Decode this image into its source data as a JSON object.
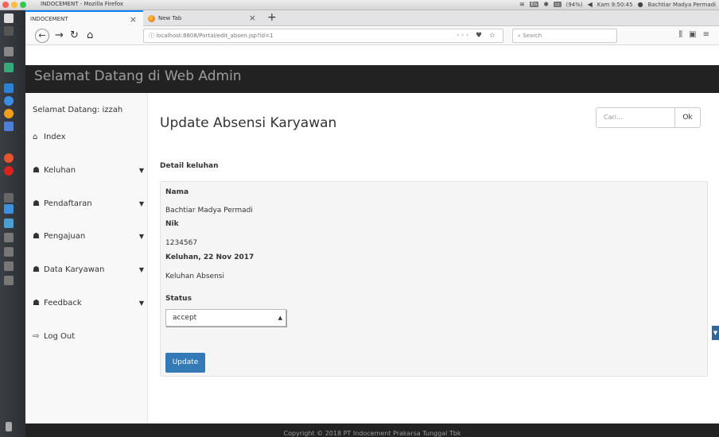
{
  "os": {
    "window_title": "INDOCEMENT - Mozilla Firefox",
    "lang": "En",
    "battery": "(94%)",
    "clock": "Kam 9:50:45",
    "user": "Bachtiar Madya Permadi"
  },
  "browser": {
    "tabs": [
      {
        "label": "INDOCEMENT"
      },
      {
        "label": "New Tab"
      }
    ],
    "url": "localhost:8808/Portal/edit_absen.jsp?id=1",
    "url_host": "localhost",
    "search_placeholder": "Search"
  },
  "header": {
    "brand": "Selamat Datang di Web Admin"
  },
  "sidebar": {
    "welcome": "Selamat Datang: izzah",
    "items": [
      {
        "label": "Index",
        "icon": "home-icon"
      },
      {
        "label": "Keluhan",
        "icon": "users-icon"
      },
      {
        "label": "Pendaftaran",
        "icon": "users-icon"
      },
      {
        "label": "Pengajuan",
        "icon": "users-icon"
      },
      {
        "label": "Data Karyawan",
        "icon": "users-icon"
      },
      {
        "label": "Feedback",
        "icon": "users-icon"
      },
      {
        "label": "Log Out",
        "icon": "logout-icon"
      }
    ]
  },
  "main": {
    "title": "Update Absensi Karyawan",
    "search_placeholder": "Cari...",
    "search_button": "Ok",
    "section_label": "Detail keluhan",
    "fields": {
      "nama_label": "Nama",
      "nama_value": "Bachtiar Madya Permadi",
      "nik_label": "Nik",
      "nik_value": "1234567",
      "keluhan_label": "Keluhan, 22 Nov 2017",
      "keluhan_value": "Keluhan Absensi",
      "status_label": "Status",
      "status_value": "accept"
    },
    "update_button": "Update"
  },
  "footer": {
    "text": "Copyright © 2018 PT Indocement Prakarsa Tunggal Tbk"
  }
}
